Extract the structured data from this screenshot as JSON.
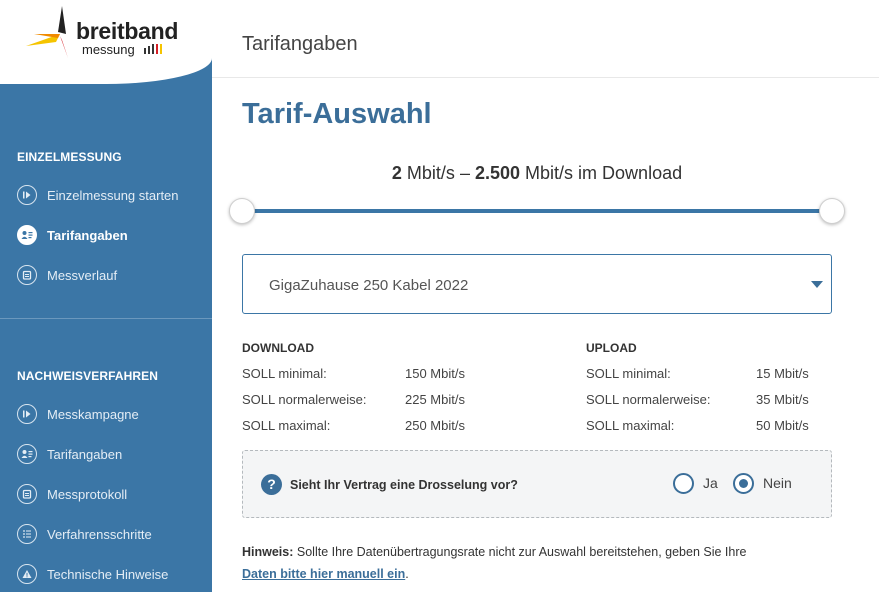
{
  "brand": {
    "name_line1": "breitband",
    "name_line2": "messung"
  },
  "sidebar": {
    "section1_title": "EINZELMESSUNG",
    "section1_items": [
      {
        "label": "Einzelmessung starten",
        "icon": "play-icon",
        "active": false
      },
      {
        "label": "Tarifangaben",
        "icon": "user-card-icon",
        "active": true
      },
      {
        "label": "Messverlauf",
        "icon": "calendar-icon",
        "active": false
      }
    ],
    "section2_title": "NACHWEISVERFAHREN",
    "section2_items": [
      {
        "label": "Messkampagne",
        "icon": "play-icon"
      },
      {
        "label": "Tarifangaben",
        "icon": "user-card-icon"
      },
      {
        "label": "Messprotokoll",
        "icon": "calendar-icon"
      },
      {
        "label": "Verfahrensschritte",
        "icon": "list-icon"
      },
      {
        "label": "Technische Hinweise",
        "icon": "warning-icon"
      }
    ]
  },
  "header": {
    "title": "Tarifangaben"
  },
  "main": {
    "title": "Tarif-Auswahl",
    "range": {
      "min_value": "2",
      "min_unit": "Mbit/s",
      "separator": "–",
      "max_value": "2.500",
      "max_unit": "Mbit/s im Download",
      "low_fraction": 0,
      "high_fraction": 1
    },
    "tariff_select": {
      "value": "GigaZuhause 250 Kabel 2022"
    },
    "download": {
      "title": "DOWNLOAD",
      "rows": [
        {
          "label": "SOLL minimal:",
          "value": "150 Mbit/s"
        },
        {
          "label": "SOLL normalerweise:",
          "value": "225 Mbit/s"
        },
        {
          "label": "SOLL maximal:",
          "value": "250 Mbit/s"
        }
      ]
    },
    "upload": {
      "title": "UPLOAD",
      "rows": [
        {
          "label": "SOLL minimal:",
          "value": "15 Mbit/s"
        },
        {
          "label": "SOLL normalerweise:",
          "value": "35 Mbit/s"
        },
        {
          "label": "SOLL maximal:",
          "value": "50 Mbit/s"
        }
      ]
    },
    "throttle_question": {
      "text": "Sieht Ihr Vertrag eine Drosselung vor?",
      "option_yes": "Ja",
      "option_no": "Nein",
      "selected": "Nein"
    },
    "hint": {
      "label": "Hinweis:",
      "text": " Sollte Ihre Datenübertragungsrate nicht zur Auswahl bereitstehen, geben Sie Ihre",
      "link": "Daten bitte hier manuell ein",
      "suffix": "."
    }
  },
  "colors": {
    "sidebar_bg": "#3b76a6",
    "accent": "#3b6e99"
  }
}
